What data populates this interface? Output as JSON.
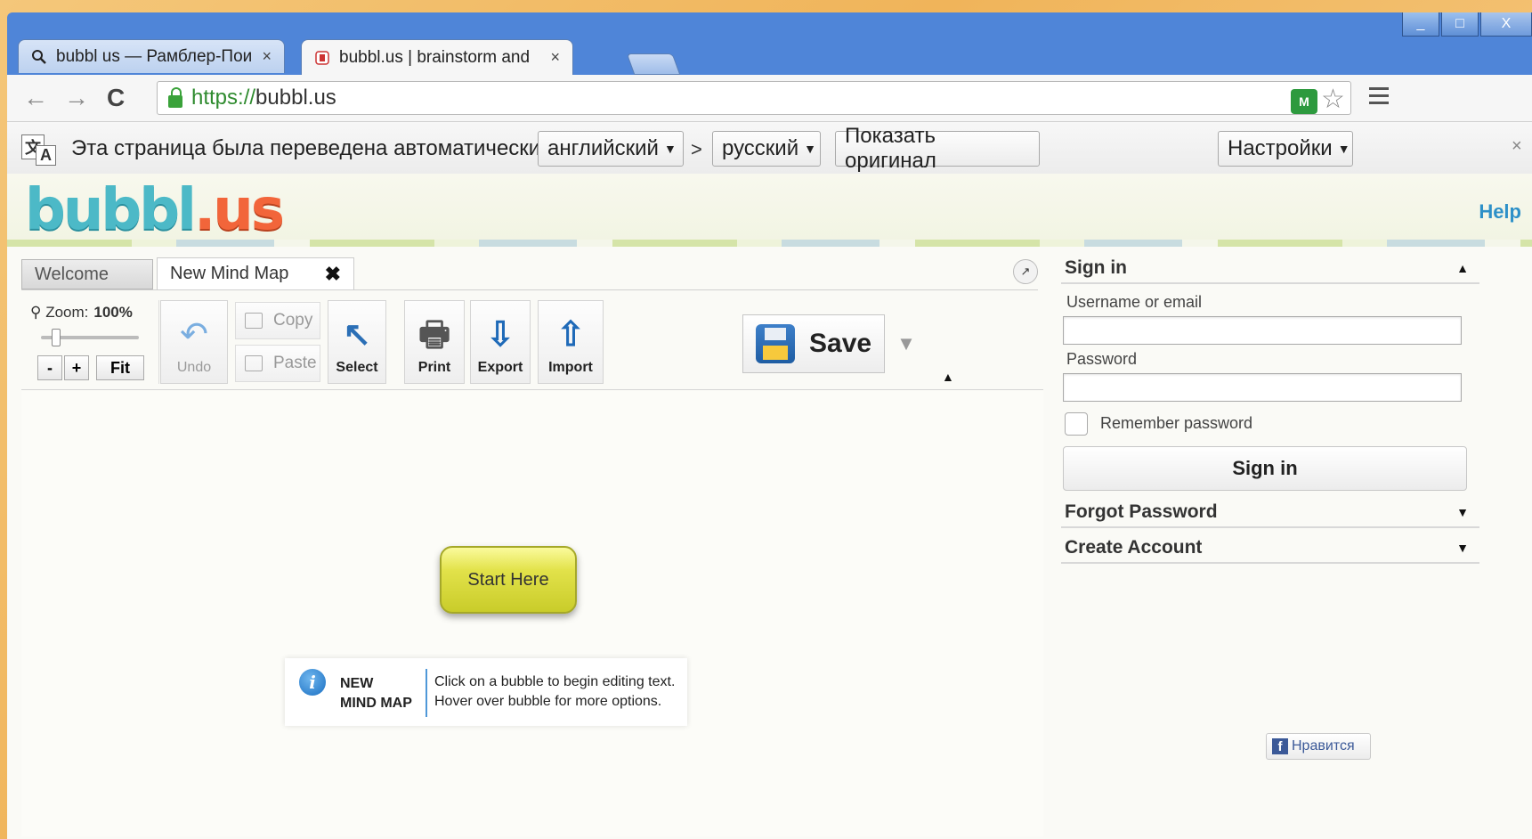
{
  "window": {
    "controls": [
      "_",
      "□",
      "X"
    ]
  },
  "browser": {
    "tabs": [
      {
        "icon": "search-icon",
        "title": "bubbl us — Рамблер-Пои",
        "close": "×"
      },
      {
        "icon": "bubbl-favicon",
        "title": "bubbl.us | brainstorm and",
        "close": "×"
      }
    ],
    "url_scheme": "https://",
    "url_host": "bubbl.us",
    "ext_label": "M"
  },
  "translate_bar": {
    "message": "Эта страница была переведена автоматически",
    "source_lang": "английский",
    "separator": ">",
    "target_lang": "русский",
    "show_original": "Показать оригинал",
    "settings": "Настройки",
    "close": "×"
  },
  "site": {
    "logo_main": "bubbl",
    "logo_dot": ".",
    "logo_tld": "us",
    "help": "Help"
  },
  "editor": {
    "tabs": [
      "Welcome",
      "New Mind Map"
    ],
    "tab_close": "✖",
    "zoom_label": "Zoom:",
    "zoom_value": "100%",
    "zoom_minus": "-",
    "zoom_plus": "+",
    "zoom_fit": "Fit",
    "undo": "Undo",
    "copy": "Copy",
    "paste": "Paste",
    "select": "Select",
    "print": "Print",
    "export": "Export",
    "import": "Import",
    "save": "Save"
  },
  "canvas": {
    "bubble_text": "Start Here",
    "info_title_1": "NEW",
    "info_title_2": "MIND MAP",
    "info_line_1": "Click on a bubble to begin editing text.",
    "info_line_2": "Hover over bubble for more options."
  },
  "sidebar": {
    "signin_header": "Sign in",
    "username_label": "Username or email",
    "password_label": "Password",
    "remember": "Remember password",
    "signin_button": "Sign in",
    "forgot": "Forgot Password",
    "create": "Create Account",
    "like": "Нравится"
  }
}
